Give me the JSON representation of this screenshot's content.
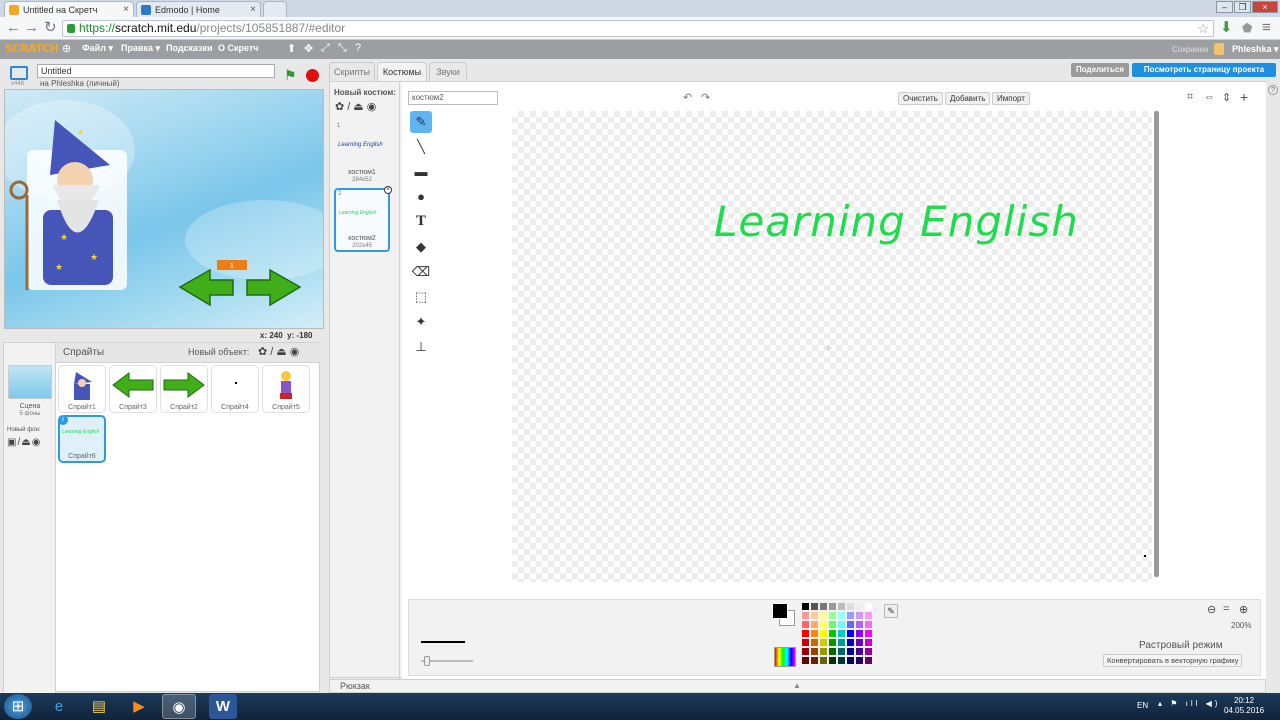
{
  "browser": {
    "tabs": [
      {
        "label": "Untitled на Скретч",
        "active": true
      },
      {
        "label": "Edmodo | Home",
        "active": false
      }
    ],
    "url_proto": "https://",
    "url_host": "scratch.mit.edu",
    "url_path": "/projects/105851887/#editor"
  },
  "menubar": {
    "logo": "SCRATCH",
    "file": "Файл ▾",
    "edit": "Правка ▾",
    "tips": "Подсказки",
    "about": "О Скретч",
    "save_status": "Сохранен",
    "user": "Phleshka ▾"
  },
  "stage": {
    "version": "v448",
    "title_value": "Untitled",
    "owner": "на Phleshka (личный)",
    "counter": "1",
    "coords_x": "x: 240",
    "coords_y": "y: -180"
  },
  "sprites_panel": {
    "header": "Спрайты",
    "new_object": "Новый объект:",
    "scene_label": "Сцена",
    "scene_backdrops": "5 фоны",
    "new_backdrop": "Новый фон:",
    "sprites": [
      {
        "name": "Спрайт1"
      },
      {
        "name": "Спрайт3"
      },
      {
        "name": "Спрайт2"
      },
      {
        "name": "Спрайт4"
      },
      {
        "name": "Спрайт5"
      },
      {
        "name": "Спрайт6",
        "selected": true
      }
    ]
  },
  "editor": {
    "tabs": [
      "Скрипты",
      "Костюмы",
      "Звуки"
    ],
    "active_tab": "Костюмы",
    "share": "Поделиться",
    "see_project": "Посмотреть страницу проекта",
    "new_costume": "Новый костюм:",
    "costumes": [
      {
        "index": "1",
        "name": "костюм1",
        "size": "284x52",
        "thumb_text": "Learning English"
      },
      {
        "index": "2",
        "name": "костюм2",
        "size": "202x45",
        "thumb_text": "Learning English",
        "selected": true
      }
    ],
    "costume_name_value": "костюм2",
    "clear": "Очистить",
    "add": "Добавить",
    "import": "Импорт",
    "canvas_text": "Learning English",
    "canvas_text_color": "#1fdc4f",
    "zoom": "200%",
    "mode": "Растровый режим",
    "convert": "Конвертировать в векторную графику",
    "backpack": "Рюкзак"
  },
  "taskbar": {
    "lang": "EN",
    "time": "20:12",
    "date": "04.05.2016"
  }
}
